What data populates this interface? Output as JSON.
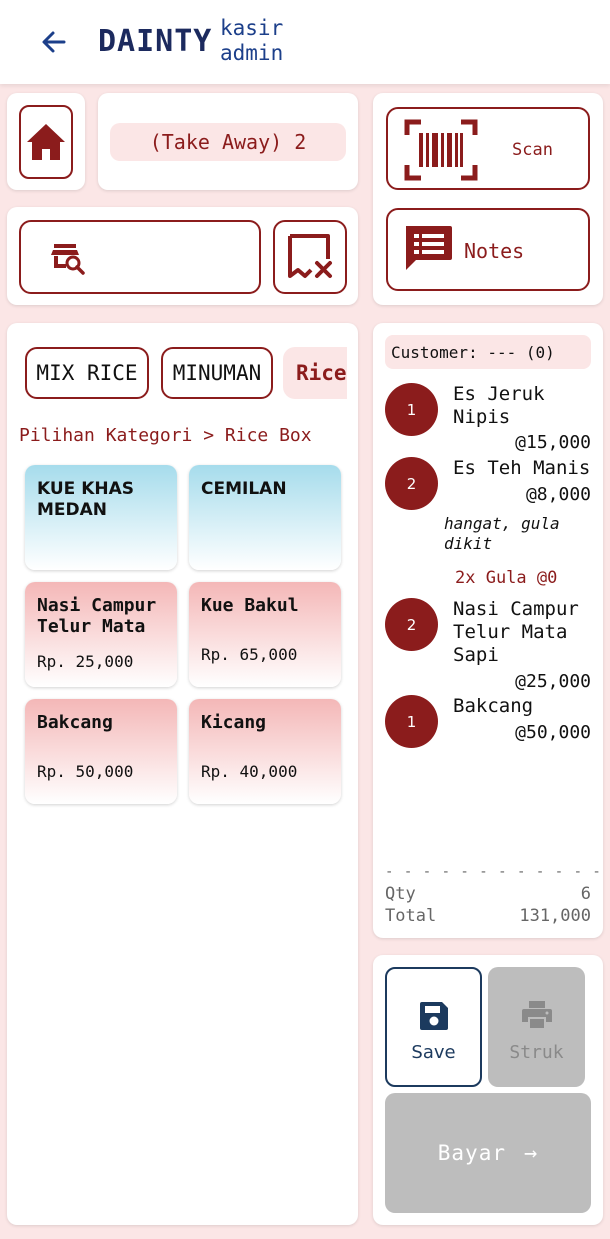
{
  "header": {
    "brand": "DAINTY",
    "role_line1": "kasir",
    "role_line2": "admin"
  },
  "order": {
    "label": "(Take Away) 2"
  },
  "actions": {
    "scan_label": "Scan",
    "notes_label": "Notes"
  },
  "categories": {
    "tabs": [
      {
        "label": "MIX RICE"
      },
      {
        "label": "MINUMAN"
      },
      {
        "label": "Rice"
      }
    ],
    "breadcrumb": "Pilihan Kategori > Rice Box"
  },
  "tiles": [
    {
      "name": "KUE KHAS MEDAN",
      "price": ""
    },
    {
      "name": "CEMILAN",
      "price": ""
    },
    {
      "name": "Nasi Campur Telur Mata",
      "price": "Rp. 25,000"
    },
    {
      "name": "Kue Bakul",
      "price": "Rp. 65,000"
    },
    {
      "name": "Bakcang",
      "price": "Rp. 50,000"
    },
    {
      "name": "Kicang",
      "price": "Rp. 40,000"
    }
  ],
  "cart": {
    "customer": "Customer: --- (0)",
    "items": [
      {
        "qty": "1",
        "name": "Es Jeruk Nipis",
        "price": "@15,000",
        "note": "",
        "addon": ""
      },
      {
        "qty": "2",
        "name": "Es Teh Manis",
        "price": "@8,000",
        "note": "hangat, gula dikit",
        "addon": "2x Gula   @0"
      },
      {
        "qty": "2",
        "name": "Nasi Campur Telur Mata Sapi",
        "price": "@25,000",
        "note": "",
        "addon": ""
      },
      {
        "qty": "1",
        "name": "Bakcang",
        "price": "@50,000",
        "note": "",
        "addon": ""
      }
    ],
    "separator": "- - - - - - - - - - - - -",
    "qty_label": "Qty",
    "qty_value": "6",
    "total_label": "Total",
    "total_value": "131,000"
  },
  "buttons": {
    "save": "Save",
    "struk": "Struk",
    "bayar": "Bayar",
    "bayar_arrow": "→"
  },
  "colors": {
    "accent": "#8b1c1c",
    "navy": "#1c2a5e",
    "background": "#fbe6e6",
    "disabled": "#bdbdbd"
  }
}
